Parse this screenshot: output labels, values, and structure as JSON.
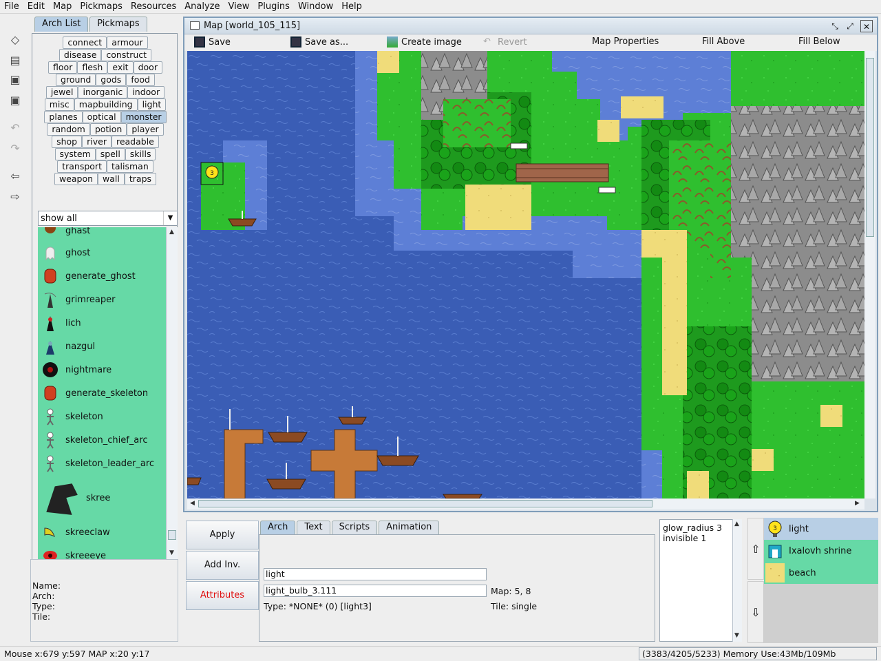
{
  "menubar": [
    "File",
    "Edit",
    "Map",
    "Pickmaps",
    "Resources",
    "Analyze",
    "View",
    "Plugins",
    "Window",
    "Help"
  ],
  "left_tabs": {
    "arch_list": "Arch List",
    "pickmaps": "Pickmaps"
  },
  "categories": [
    [
      "connect",
      "armour"
    ],
    [
      "disease",
      "construct"
    ],
    [
      "floor",
      "flesh",
      "exit",
      "door"
    ],
    [
      "ground",
      "gods",
      "food"
    ],
    [
      "jewel",
      "inorganic",
      "indoor"
    ],
    [
      "misc",
      "mapbuilding",
      "light"
    ],
    [
      "planes",
      "optical",
      "monster"
    ],
    [
      "random",
      "potion",
      "player"
    ],
    [
      "shop",
      "river",
      "readable"
    ],
    [
      "system",
      "spell",
      "skills"
    ],
    [
      "transport",
      "talisman"
    ],
    [
      "weapon",
      "wall",
      "traps"
    ]
  ],
  "active_category": "monster",
  "filter": "show all",
  "arch_items": [
    {
      "label": "ghast",
      "icon": "ghast-icon"
    },
    {
      "label": "ghost",
      "icon": "ghost-icon"
    },
    {
      "label": "generate_ghost",
      "icon": "generator-icon"
    },
    {
      "label": "grimreaper",
      "icon": "grimreaper-icon"
    },
    {
      "label": "lich",
      "icon": "lich-icon"
    },
    {
      "label": "nazgul",
      "icon": "nazgul-icon"
    },
    {
      "label": "nightmare",
      "icon": "nightmare-icon"
    },
    {
      "label": "generate_skeleton",
      "icon": "generator-icon"
    },
    {
      "label": "skeleton",
      "icon": "skeleton-icon"
    },
    {
      "label": "skeleton_chief_arc",
      "icon": "skeleton-icon"
    },
    {
      "label": "skeleton_leader_arc",
      "icon": "skeleton-icon"
    },
    {
      "label": "skree",
      "icon": "skree-icon"
    },
    {
      "label": "skreeclaw",
      "icon": "claw-icon"
    },
    {
      "label": "skreeeye",
      "icon": "eye-icon"
    }
  ],
  "info": {
    "name": "Name:",
    "arch": "Arch:",
    "type": "Type:",
    "tile": "Tile:"
  },
  "map_window": {
    "title": "Map [world_105_115]",
    "toolbar": {
      "save": "Save",
      "save_as": "Save as...",
      "create_image": "Create image",
      "revert": "Revert",
      "map_properties": "Map Properties",
      "fill_above": "Fill Above",
      "fill_below": "Fill Below"
    }
  },
  "buttons": {
    "apply": "Apply",
    "add_inv": "Add Inv.",
    "attributes": "Attributes"
  },
  "attr_tabs": [
    "Arch",
    "Text",
    "Scripts",
    "Animation"
  ],
  "attributes": {
    "name_value": "light",
    "arch_value": "light_bulb_3.111",
    "map_pos": "Map: 5, 8",
    "type_text": "Type: *NONE* (0) [light3]",
    "tile_text": "Tile: single"
  },
  "msg_lines": [
    "glow_radius 3",
    "invisible 1"
  ],
  "stack": [
    {
      "label": "light",
      "icon": "light-bulb-icon"
    },
    {
      "label": "Ixalovh shrine",
      "icon": "shrine-icon"
    },
    {
      "label": "beach",
      "icon": "beach-icon"
    }
  ],
  "status": {
    "mouse": "Mouse x:679 y:597  MAP x:20 y:17",
    "memory": "(3383/4205/5233) Memory Use:43Mb/109Mb"
  },
  "colors": {
    "water": "#3a5db5",
    "grass": "#2fbf2f",
    "forest": "#138a13",
    "mountain": "#9a9a9a",
    "sand": "#f0dc7a",
    "list_bg": "#66d9a6",
    "selected": "#b8cfe5"
  }
}
